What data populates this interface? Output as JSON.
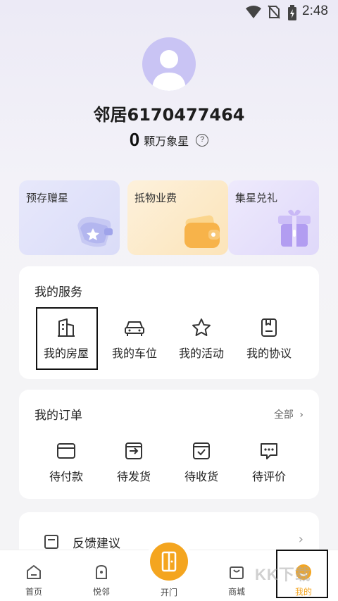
{
  "status_bar": {
    "time": "2:48",
    "icons": [
      "wifi-icon",
      "no-sim-icon",
      "battery-icon"
    ]
  },
  "profile": {
    "nickname": "邻居6170477464",
    "stars_count": "0",
    "stars_label": "颗万象星"
  },
  "promos": [
    {
      "label": "预存赠星",
      "art": "wallet-star-icon"
    },
    {
      "label": "抵物业费",
      "art": "wallet-icon"
    },
    {
      "label": "集星兑礼",
      "art": "gift-icon"
    }
  ],
  "services": {
    "title": "我的服务",
    "items": [
      {
        "label": "我的房屋",
        "icon": "building-icon"
      },
      {
        "label": "我的车位",
        "icon": "car-icon"
      },
      {
        "label": "我的活动",
        "icon": "star-icon"
      },
      {
        "label": "我的协议",
        "icon": "document-icon"
      }
    ]
  },
  "orders": {
    "title": "我的订单",
    "view_all": "全部",
    "items": [
      {
        "label": "待付款",
        "icon": "card-icon"
      },
      {
        "label": "待发货",
        "icon": "ship-icon"
      },
      {
        "label": "待收货",
        "icon": "receive-icon"
      },
      {
        "label": "待评价",
        "icon": "comment-icon"
      }
    ]
  },
  "feedback": {
    "label": "反馈建议"
  },
  "bottom_nav": {
    "items": [
      {
        "label": "首页",
        "icon": "home-icon"
      },
      {
        "label": "悦邻",
        "icon": "neighbor-icon"
      },
      {
        "label": "开门",
        "icon": "door-icon"
      },
      {
        "label": "商城",
        "icon": "bag-icon"
      },
      {
        "label": "我的",
        "icon": "profile-icon"
      }
    ]
  },
  "colors": {
    "accent": "#f4a51f",
    "avatar_bg": "#c9c4f4"
  },
  "watermark": "KK下载"
}
